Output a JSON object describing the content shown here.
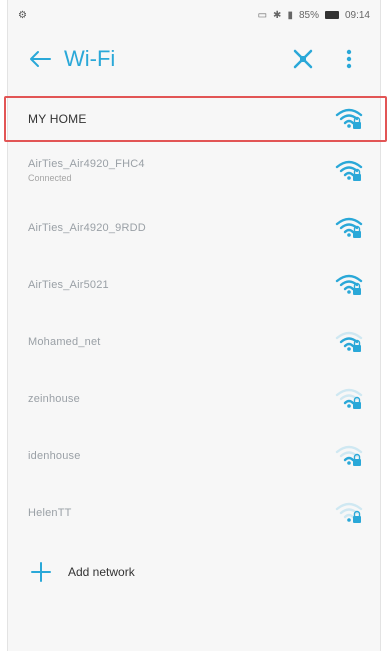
{
  "statusbar": {
    "left_glyph": "⚙",
    "battery_text": "85%",
    "time": "09:14"
  },
  "appbar": {
    "title": "Wi-Fi"
  },
  "networks": [
    {
      "ssid": "MY HOME",
      "sub": "",
      "strength": 4,
      "dim": false
    },
    {
      "ssid": "AirTies_Air4920_FHC4",
      "sub": "Connected",
      "strength": 4,
      "dim": true
    },
    {
      "ssid": "AirTies_Air4920_9RDD",
      "sub": "",
      "strength": 4,
      "dim": true
    },
    {
      "ssid": "AirTies_Air5021",
      "sub": "",
      "strength": 4,
      "dim": true
    },
    {
      "ssid": "Mohamed_net",
      "sub": "",
      "strength": 3,
      "dim": true
    },
    {
      "ssid": "zeinhouse",
      "sub": "",
      "strength": 2,
      "dim": true
    },
    {
      "ssid": "idenhouse",
      "sub": "",
      "strength": 2,
      "dim": true
    },
    {
      "ssid": "HelenTT",
      "sub": "",
      "strength": 1,
      "dim": true
    }
  ],
  "add_network": {
    "label": "Add network"
  },
  "colors": {
    "accent": "#2aa8d8",
    "highlight": "#e25555"
  }
}
